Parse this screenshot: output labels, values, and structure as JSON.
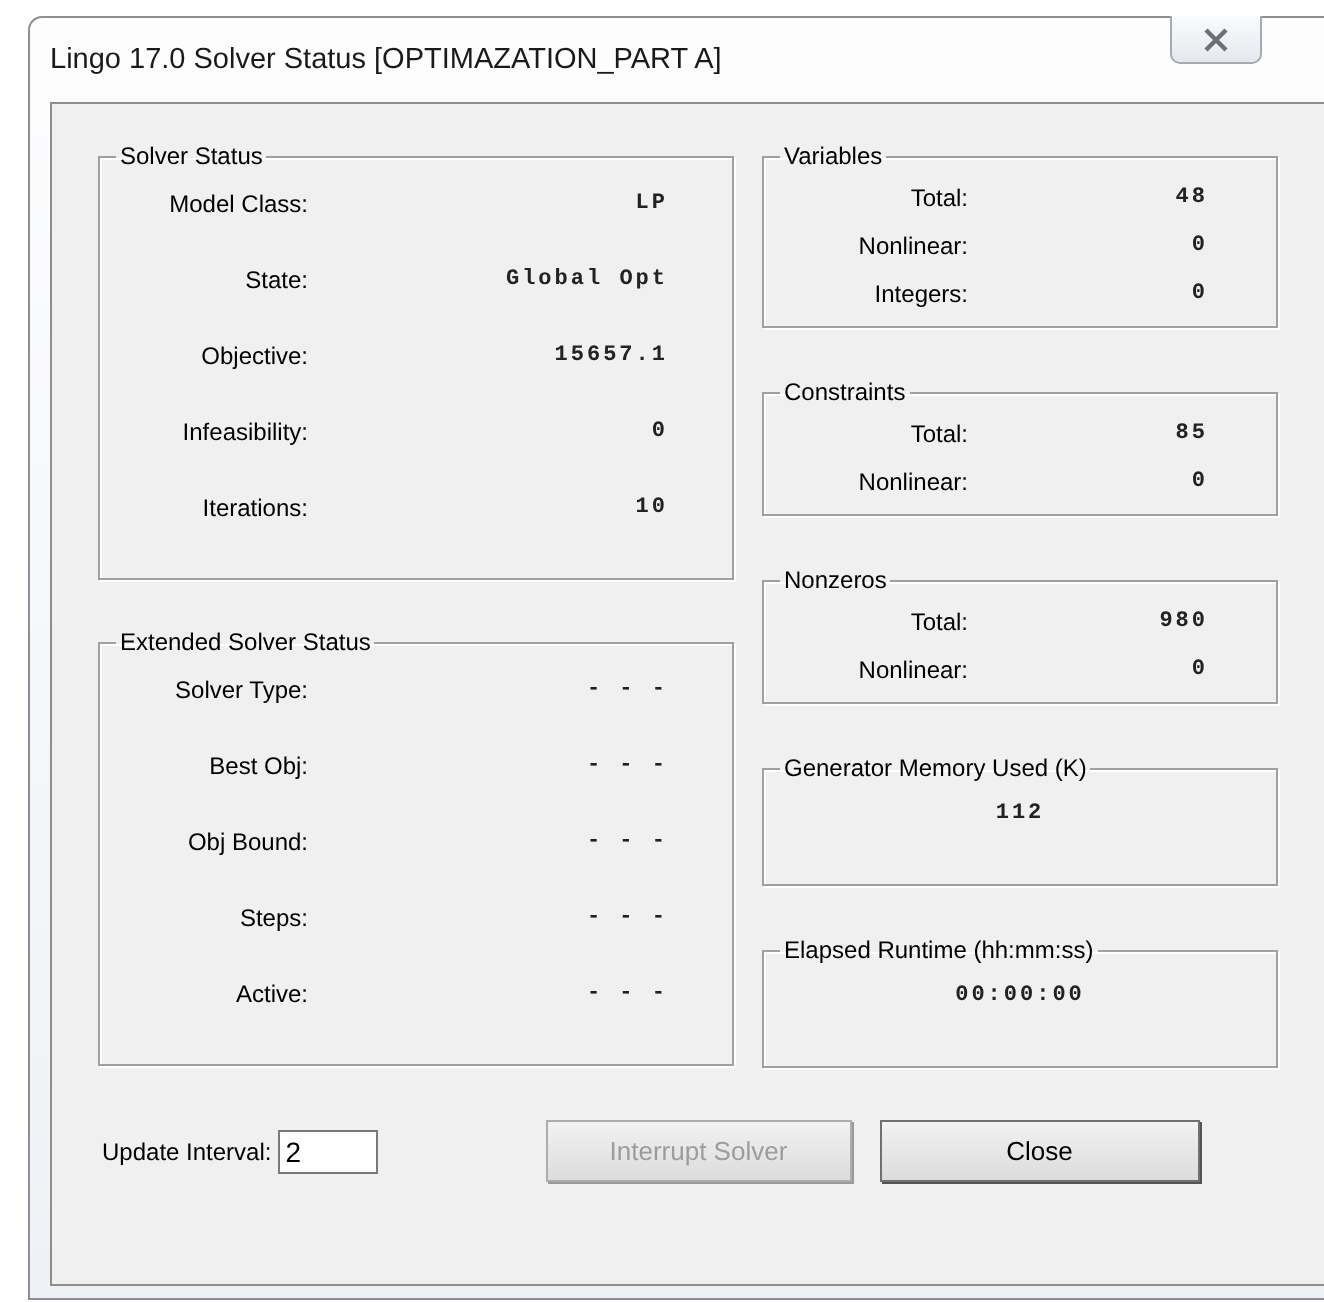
{
  "window": {
    "title": "Lingo 17.0 Solver Status [OPTIMAZATION_PART A]"
  },
  "left_groups": [
    {
      "title": "Solver Status",
      "kind": "rows",
      "rows": [
        {
          "label": "Model Class:",
          "value": "LP"
        },
        {
          "label": "State:",
          "value": "Global Opt"
        },
        {
          "label": "Objective:",
          "value": "15657.1"
        },
        {
          "label": "Infeasibility:",
          "value": "0"
        },
        {
          "label": "Iterations:",
          "value": "10"
        }
      ]
    },
    {
      "title": "Extended Solver Status",
      "kind": "rows",
      "rows": [
        {
          "label": "Solver Type:",
          "value": "- - -"
        },
        {
          "label": "Best Obj:",
          "value": "- - -"
        },
        {
          "label": "Obj Bound:",
          "value": "- - -"
        },
        {
          "label": "Steps:",
          "value": "- - -"
        },
        {
          "label": "Active:",
          "value": "- - -"
        }
      ]
    }
  ],
  "right_groups": [
    {
      "title": "Variables",
      "kind": "rows",
      "rows": [
        {
          "label": "Total:",
          "value": "48"
        },
        {
          "label": "Nonlinear:",
          "value": "0"
        },
        {
          "label": "Integers:",
          "value": "0"
        }
      ]
    },
    {
      "title": "Constraints",
      "kind": "rows",
      "rows": [
        {
          "label": "Total:",
          "value": "85"
        },
        {
          "label": "Nonlinear:",
          "value": "0"
        }
      ]
    },
    {
      "title": "Nonzeros",
      "kind": "rows",
      "rows": [
        {
          "label": "Total:",
          "value": "980"
        },
        {
          "label": "Nonlinear:",
          "value": "0"
        }
      ]
    },
    {
      "title": "Generator Memory Used (K)",
      "kind": "single",
      "value": "112"
    },
    {
      "title": "Elapsed Runtime (hh:mm:ss)",
      "kind": "single",
      "value": "00:00:00"
    }
  ],
  "update_interval": {
    "label": "Update Interval:",
    "value": "2"
  },
  "buttons": [
    {
      "label": "Interrupt Solver",
      "disabled": true
    },
    {
      "label": "Close",
      "disabled": false
    }
  ]
}
